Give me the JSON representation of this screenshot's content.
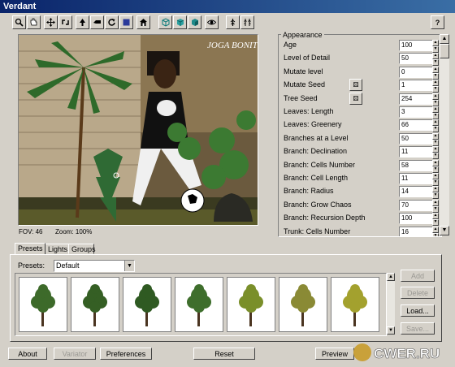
{
  "window": {
    "title": "Verdant"
  },
  "toolbar": {
    "icons": [
      "zoom-icon",
      "hand-icon",
      "move-icon",
      "rotate-icon",
      "tree-edit-icon",
      "prune-icon",
      "redo-icon",
      "square-icon",
      "home-icon",
      "cube-icon",
      "cube-solid-icon",
      "cube-shaded-icon",
      "eye-icon",
      "single-tree-icon",
      "tree-group-icon"
    ],
    "help_label": "?"
  },
  "viewport": {
    "caption_text": "JOGA BONITO",
    "fov_label": "FOV:",
    "fov_value": "46",
    "zoom_label": "Zoom:",
    "zoom_value": "100%"
  },
  "appearance": {
    "group_label": "Appearance",
    "params": [
      {
        "label": "Age",
        "value": "100"
      },
      {
        "label": "Level of Detail",
        "value": "50"
      },
      {
        "label": "Mutate level",
        "value": "0"
      },
      {
        "label": "Mutate Seed",
        "value": "1",
        "seed_button": true
      },
      {
        "label": "Tree Seed",
        "value": "254",
        "seed_button": true
      },
      {
        "label": "Leaves: Length",
        "value": "3"
      },
      {
        "label": "Leaves: Greenery",
        "value": "66"
      },
      {
        "label": "Branches at a Level",
        "value": "50"
      },
      {
        "label": "Branch: Declination",
        "value": "11"
      },
      {
        "label": "Branch: Cells Number",
        "value": "58"
      },
      {
        "label": "Branch: Cell Length",
        "value": "11"
      },
      {
        "label": "Branch: Radius",
        "value": "14"
      },
      {
        "label": "Branch: Grow Chaos",
        "value": "70"
      },
      {
        "label": "Branch: Recursion Depth",
        "value": "100"
      },
      {
        "label": "Trunk: Cells Number",
        "value": "16"
      }
    ]
  },
  "tabs": [
    {
      "label": "Presets",
      "active": true
    },
    {
      "label": "Lights",
      "active": false
    },
    {
      "label": "Groups",
      "active": false
    }
  ],
  "presets": {
    "label": "Presets:",
    "selected": "Default",
    "thumbnails": [
      {
        "name": "preset-tree-1",
        "foliage": "#3d6a2a"
      },
      {
        "name": "preset-tree-2",
        "foliage": "#355f24"
      },
      {
        "name": "preset-tree-3",
        "foliage": "#2f5a22"
      },
      {
        "name": "preset-tree-4",
        "foliage": "#3e6e2c"
      },
      {
        "name": "preset-tree-5",
        "foliage": "#7a8f2a"
      },
      {
        "name": "preset-tree-6",
        "foliage": "#8a8a35"
      },
      {
        "name": "preset-tree-7",
        "foliage": "#a3a12e"
      }
    ],
    "side_buttons": [
      {
        "label": "Add",
        "enabled": false
      },
      {
        "label": "Delete",
        "enabled": false
      },
      {
        "label": "Load...",
        "enabled": true
      },
      {
        "label": "Save...",
        "enabled": false
      }
    ]
  },
  "bottom": {
    "about": "About",
    "variator": "Variator",
    "preferences": "Preferences",
    "reset": "Reset",
    "preview": "Preview"
  },
  "watermark": {
    "text": "CWER.RU"
  }
}
